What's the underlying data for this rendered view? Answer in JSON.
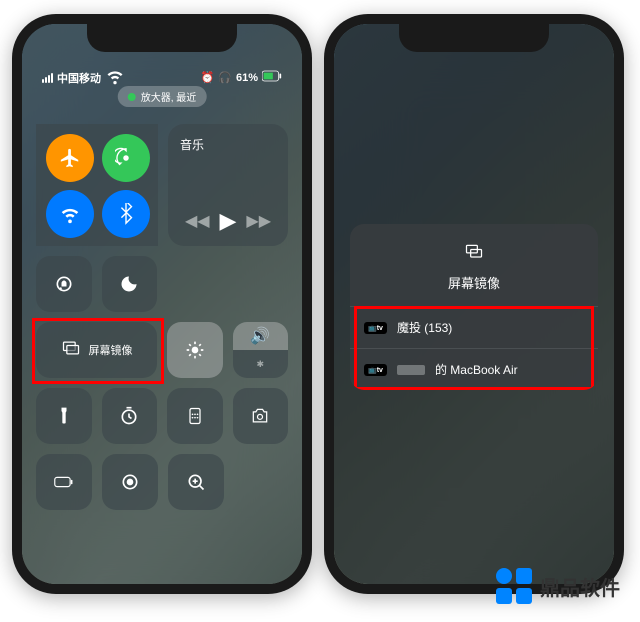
{
  "phone1": {
    "camera_indicator": "放大器, 最近",
    "status": {
      "carrier": "中国移动",
      "battery": "61%"
    },
    "music": {
      "title": "音乐"
    },
    "screen_mirror": {
      "label": "屏幕镜像"
    }
  },
  "phone2": {
    "mirror_popup": {
      "title": "屏幕镜像",
      "items": [
        {
          "badge": "tv",
          "label": "魔投 (153)"
        },
        {
          "badge": "tv",
          "label": "的 MacBook Air"
        }
      ]
    }
  },
  "watermark": {
    "text": "鼎品软件"
  }
}
